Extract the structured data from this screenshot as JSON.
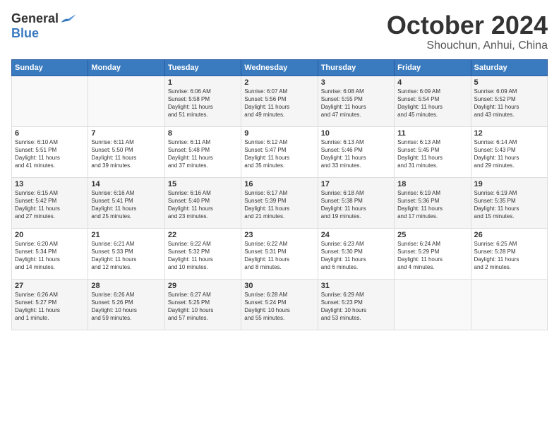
{
  "header": {
    "logo_general": "General",
    "logo_blue": "Blue",
    "title": "October 2024",
    "subtitle": "Shouchun, Anhui, China"
  },
  "weekdays": [
    "Sunday",
    "Monday",
    "Tuesday",
    "Wednesday",
    "Thursday",
    "Friday",
    "Saturday"
  ],
  "weeks": [
    [
      {
        "day": "",
        "info": ""
      },
      {
        "day": "",
        "info": ""
      },
      {
        "day": "1",
        "info": "Sunrise: 6:06 AM\nSunset: 5:58 PM\nDaylight: 11 hours\nand 51 minutes."
      },
      {
        "day": "2",
        "info": "Sunrise: 6:07 AM\nSunset: 5:56 PM\nDaylight: 11 hours\nand 49 minutes."
      },
      {
        "day": "3",
        "info": "Sunrise: 6:08 AM\nSunset: 5:55 PM\nDaylight: 11 hours\nand 47 minutes."
      },
      {
        "day": "4",
        "info": "Sunrise: 6:09 AM\nSunset: 5:54 PM\nDaylight: 11 hours\nand 45 minutes."
      },
      {
        "day": "5",
        "info": "Sunrise: 6:09 AM\nSunset: 5:52 PM\nDaylight: 11 hours\nand 43 minutes."
      }
    ],
    [
      {
        "day": "6",
        "info": "Sunrise: 6:10 AM\nSunset: 5:51 PM\nDaylight: 11 hours\nand 41 minutes."
      },
      {
        "day": "7",
        "info": "Sunrise: 6:11 AM\nSunset: 5:50 PM\nDaylight: 11 hours\nand 39 minutes."
      },
      {
        "day": "8",
        "info": "Sunrise: 6:11 AM\nSunset: 5:48 PM\nDaylight: 11 hours\nand 37 minutes."
      },
      {
        "day": "9",
        "info": "Sunrise: 6:12 AM\nSunset: 5:47 PM\nDaylight: 11 hours\nand 35 minutes."
      },
      {
        "day": "10",
        "info": "Sunrise: 6:13 AM\nSunset: 5:46 PM\nDaylight: 11 hours\nand 33 minutes."
      },
      {
        "day": "11",
        "info": "Sunrise: 6:13 AM\nSunset: 5:45 PM\nDaylight: 11 hours\nand 31 minutes."
      },
      {
        "day": "12",
        "info": "Sunrise: 6:14 AM\nSunset: 5:43 PM\nDaylight: 11 hours\nand 29 minutes."
      }
    ],
    [
      {
        "day": "13",
        "info": "Sunrise: 6:15 AM\nSunset: 5:42 PM\nDaylight: 11 hours\nand 27 minutes."
      },
      {
        "day": "14",
        "info": "Sunrise: 6:16 AM\nSunset: 5:41 PM\nDaylight: 11 hours\nand 25 minutes."
      },
      {
        "day": "15",
        "info": "Sunrise: 6:16 AM\nSunset: 5:40 PM\nDaylight: 11 hours\nand 23 minutes."
      },
      {
        "day": "16",
        "info": "Sunrise: 6:17 AM\nSunset: 5:39 PM\nDaylight: 11 hours\nand 21 minutes."
      },
      {
        "day": "17",
        "info": "Sunrise: 6:18 AM\nSunset: 5:38 PM\nDaylight: 11 hours\nand 19 minutes."
      },
      {
        "day": "18",
        "info": "Sunrise: 6:19 AM\nSunset: 5:36 PM\nDaylight: 11 hours\nand 17 minutes."
      },
      {
        "day": "19",
        "info": "Sunrise: 6:19 AM\nSunset: 5:35 PM\nDaylight: 11 hours\nand 15 minutes."
      }
    ],
    [
      {
        "day": "20",
        "info": "Sunrise: 6:20 AM\nSunset: 5:34 PM\nDaylight: 11 hours\nand 14 minutes."
      },
      {
        "day": "21",
        "info": "Sunrise: 6:21 AM\nSunset: 5:33 PM\nDaylight: 11 hours\nand 12 minutes."
      },
      {
        "day": "22",
        "info": "Sunrise: 6:22 AM\nSunset: 5:32 PM\nDaylight: 11 hours\nand 10 minutes."
      },
      {
        "day": "23",
        "info": "Sunrise: 6:22 AM\nSunset: 5:31 PM\nDaylight: 11 hours\nand 8 minutes."
      },
      {
        "day": "24",
        "info": "Sunrise: 6:23 AM\nSunset: 5:30 PM\nDaylight: 11 hours\nand 6 minutes."
      },
      {
        "day": "25",
        "info": "Sunrise: 6:24 AM\nSunset: 5:29 PM\nDaylight: 11 hours\nand 4 minutes."
      },
      {
        "day": "26",
        "info": "Sunrise: 6:25 AM\nSunset: 5:28 PM\nDaylight: 11 hours\nand 2 minutes."
      }
    ],
    [
      {
        "day": "27",
        "info": "Sunrise: 6:26 AM\nSunset: 5:27 PM\nDaylight: 11 hours\nand 1 minute."
      },
      {
        "day": "28",
        "info": "Sunrise: 6:26 AM\nSunset: 5:26 PM\nDaylight: 10 hours\nand 59 minutes."
      },
      {
        "day": "29",
        "info": "Sunrise: 6:27 AM\nSunset: 5:25 PM\nDaylight: 10 hours\nand 57 minutes."
      },
      {
        "day": "30",
        "info": "Sunrise: 6:28 AM\nSunset: 5:24 PM\nDaylight: 10 hours\nand 55 minutes."
      },
      {
        "day": "31",
        "info": "Sunrise: 6:29 AM\nSunset: 5:23 PM\nDaylight: 10 hours\nand 53 minutes."
      },
      {
        "day": "",
        "info": ""
      },
      {
        "day": "",
        "info": ""
      }
    ]
  ]
}
